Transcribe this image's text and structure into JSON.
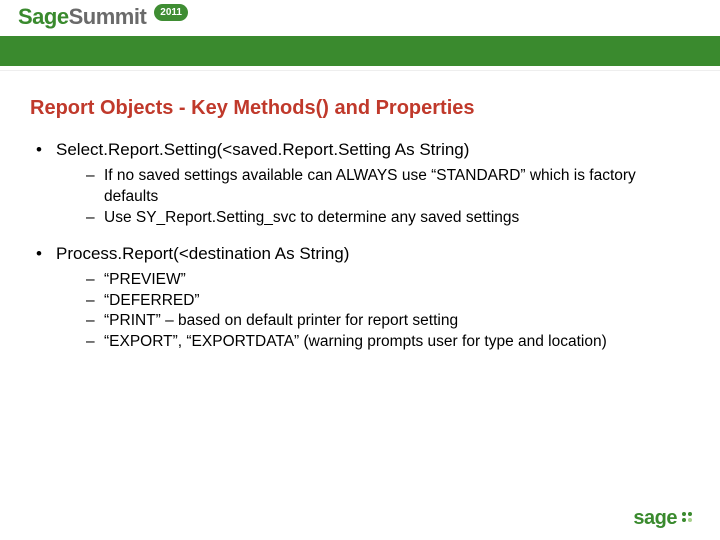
{
  "header": {
    "brand_first": "Sage",
    "brand_second": "Summit",
    "year": "2011"
  },
  "title": "Report Objects - Key Methods() and Properties",
  "bullets": [
    {
      "text": "Select.Report.Setting(<saved.Report.Setting As String)",
      "sub": [
        "If no saved settings available can ALWAYS use “STANDARD” which is factory defaults",
        "Use SY_Report.Setting_svc to determine any saved settings"
      ]
    },
    {
      "text": "Process.Report(<destination As String)",
      "sub": [
        "“PREVIEW”",
        "“DEFERRED”",
        "“PRINT” – based on default printer for report setting",
        "“EXPORT”, “EXPORTDATA” (warning prompts user for type and location)"
      ]
    }
  ],
  "footer": {
    "brand": "sage"
  }
}
